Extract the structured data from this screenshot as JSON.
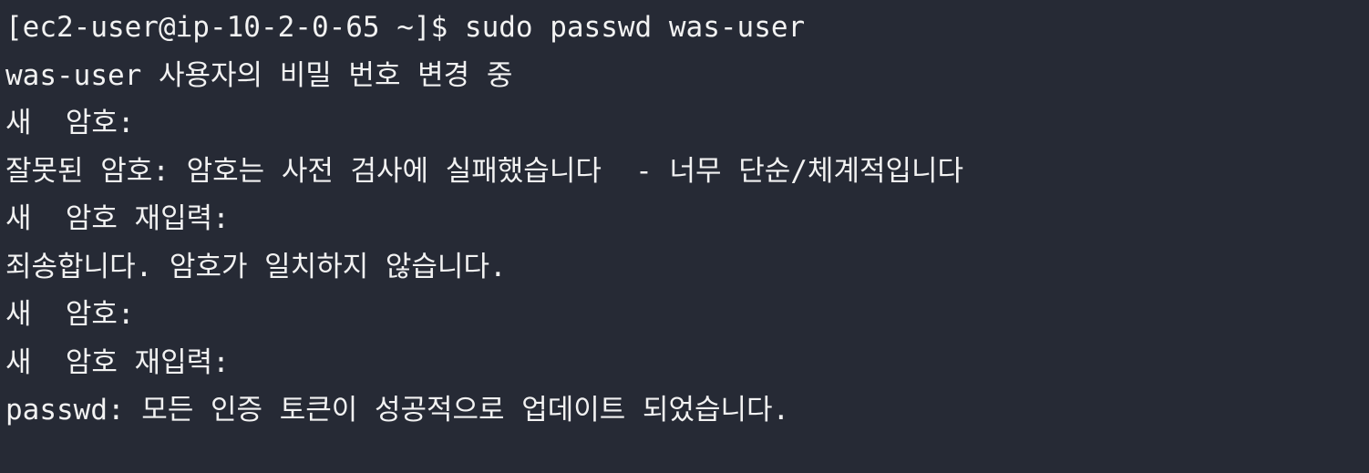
{
  "terminal": {
    "lines": [
      "[ec2-user@ip-10-2-0-65 ~]$ sudo passwd was-user",
      "was-user 사용자의 비밀 번호 변경 중",
      "새  암호:",
      "잘못된 암호: 암호는 사전 검사에 실패했습니다  - 너무 단순/체계적입니다",
      "새  암호 재입력:",
      "죄송합니다. 암호가 일치하지 않습니다.",
      "새  암호:",
      "새  암호 재입력:",
      "passwd: 모든 인증 토큰이 성공적으로 업데이트 되었습니다."
    ]
  }
}
